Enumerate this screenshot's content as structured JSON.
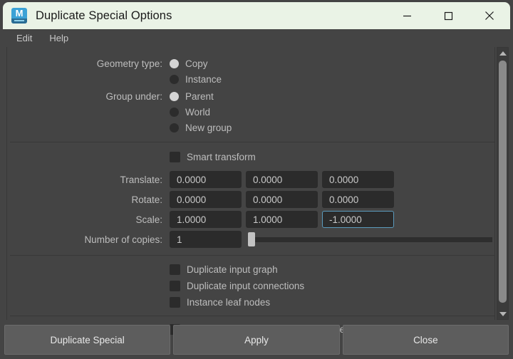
{
  "window": {
    "title": "Duplicate Special Options",
    "app_icon": "maya-icon",
    "icon_letter": "M",
    "controls": {
      "minimize": "minimize-icon",
      "maximize": "maximize-icon",
      "close": "close-icon"
    },
    "colors": {
      "titlebar_bg": "#eaf3e6",
      "dialog_bg": "#444444",
      "field_bg": "#2b2b2b",
      "focus_border": "#5b9bbd",
      "button_bg": "#5d5d5d",
      "text": "#bdbdbd"
    }
  },
  "menubar": {
    "items": [
      {
        "label": "Edit"
      },
      {
        "label": "Help"
      }
    ]
  },
  "form": {
    "geometry_type": {
      "label": "Geometry type:",
      "options": [
        {
          "label": "Copy",
          "selected": true
        },
        {
          "label": "Instance",
          "selected": false
        }
      ]
    },
    "group_under": {
      "label": "Group under:",
      "options": [
        {
          "label": "Parent",
          "selected": true
        },
        {
          "label": "World",
          "selected": false
        },
        {
          "label": "New group",
          "selected": false
        }
      ]
    },
    "smart_transform": {
      "label": "Smart transform",
      "checked": false
    },
    "translate": {
      "label": "Translate:",
      "values": [
        "0.0000",
        "0.0000",
        "0.0000"
      ]
    },
    "rotate": {
      "label": "Rotate:",
      "values": [
        "0.0000",
        "0.0000",
        "0.0000"
      ]
    },
    "scale": {
      "label": "Scale:",
      "values": [
        "1.0000",
        "1.0000",
        "-1.0000"
      ],
      "focused_index": 2
    },
    "number_of_copies": {
      "label": "Number of copies:",
      "value": "1",
      "slider_position_percent": 0
    },
    "checkboxes": [
      {
        "label": "Duplicate input graph",
        "checked": false
      },
      {
        "label": "Duplicate input connections",
        "checked": false
      },
      {
        "label": "Instance leaf nodes",
        "checked": false
      }
    ],
    "checkboxes_extra": [
      {
        "label": "Assign unique name to children nodes",
        "checked": false
      }
    ]
  },
  "buttons": [
    {
      "label": "Duplicate Special"
    },
    {
      "label": "Apply"
    },
    {
      "label": "Close"
    }
  ]
}
